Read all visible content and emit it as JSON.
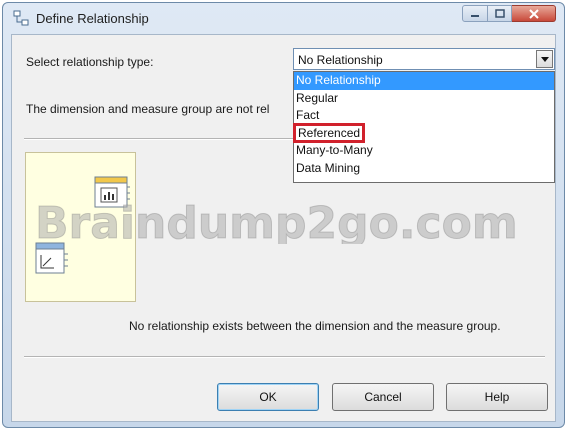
{
  "window": {
    "title": "Define Relationship"
  },
  "form": {
    "type_label": "Select relationship type:",
    "selected_value": "No Relationship",
    "status_text": "The dimension and measure group are not rel"
  },
  "dropdown": {
    "options": [
      "No Relationship",
      "Regular",
      "Fact",
      "Referenced",
      "Many-to-Many",
      "Data Mining"
    ]
  },
  "description": "No relationship exists between the dimension and the measure group.",
  "buttons": {
    "ok": "OK",
    "cancel": "Cancel",
    "help": "Help"
  },
  "watermark": "Braindump2go.com",
  "colors": {
    "selection": "#3399ff",
    "highlight_box": "#d1212c",
    "diagram_bg": "#ffffe1"
  },
  "icons": {
    "app": "relationship-icon",
    "measure_group": "measure-group-icon",
    "dimension": "dimension-icon"
  }
}
